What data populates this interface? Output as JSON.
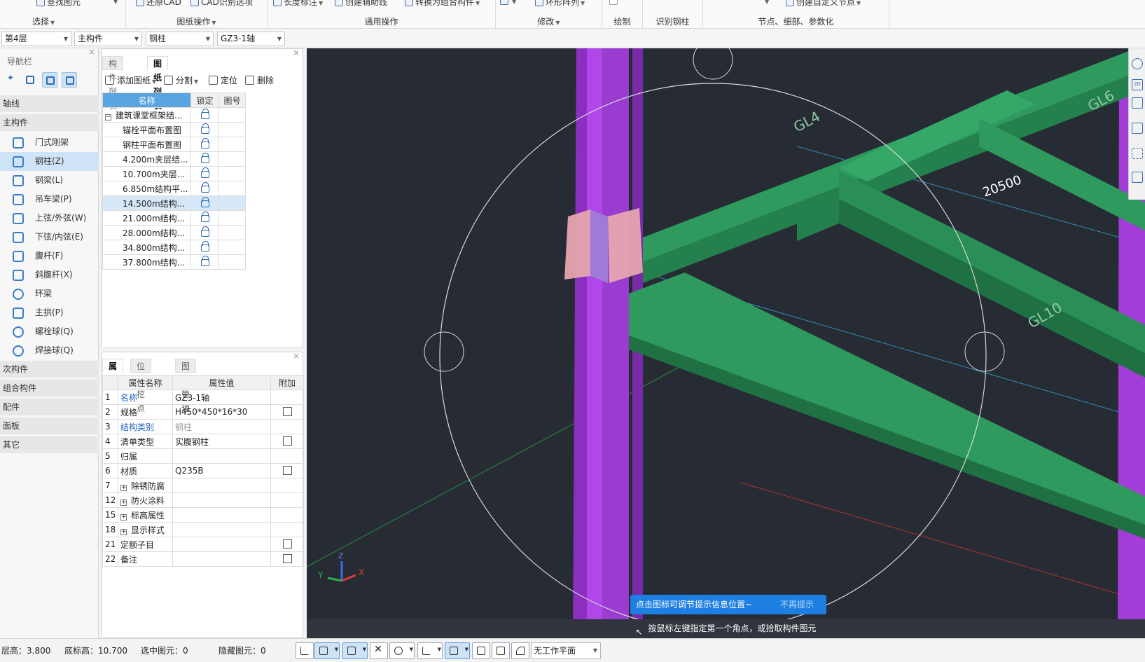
{
  "ribbon": {
    "select": {
      "items": [
        "查找图元"
      ],
      "label": "选择"
    },
    "drawing_ops": {
      "items": [
        "还原CAD",
        "CAD识别选项"
      ],
      "label": "图纸操作"
    },
    "general_ops": {
      "items": [
        "长度标注",
        "创建辅助线",
        "转换为组合构件"
      ],
      "label": "通用操作"
    },
    "modify": {
      "items": [
        "环形阵列"
      ],
      "label": "修改"
    },
    "draw": {
      "label": "绘制"
    },
    "identify": {
      "label": "识别钢柱"
    },
    "nodes": {
      "items": [
        "创建自定义节点"
      ],
      "label": "节点、细部、参数化"
    }
  },
  "selectors": {
    "floor": "第4层",
    "component_type": "主构件",
    "component": "钢柱",
    "instance": "GZ3-1轴"
  },
  "nav": {
    "title": "导航栏",
    "categories": {
      "axis": "轴线",
      "main": "主构件",
      "secondary": "次构件",
      "combo": "组合构件",
      "fittings": "配件",
      "panel": "面板",
      "other": "其它"
    },
    "items": [
      {
        "label": "门式刚架",
        "icon": "portal-frame-icon"
      },
      {
        "label": "钢柱(Z)",
        "icon": "steel-column-icon"
      },
      {
        "label": "钢梁(L)",
        "icon": "steel-beam-icon"
      },
      {
        "label": "吊车梁(P)",
        "icon": "crane-beam-icon"
      },
      {
        "label": "上弦/外弦(W)",
        "icon": "upper-chord-icon"
      },
      {
        "label": "下弦/内弦(E)",
        "icon": "lower-chord-icon"
      },
      {
        "label": "腹杆(F)",
        "icon": "web-member-icon"
      },
      {
        "label": "斜腹杆(X)",
        "icon": "diagonal-web-icon"
      },
      {
        "label": "环梁",
        "icon": "ring-beam-icon"
      },
      {
        "label": "主拱(P)",
        "icon": "main-arch-icon"
      },
      {
        "label": "螺栓球(Q)",
        "icon": "bolt-ball-icon"
      },
      {
        "label": "焊接球(Q)",
        "icon": "weld-ball-icon"
      }
    ]
  },
  "drawing_panel": {
    "tabs": [
      "构件列表",
      "图纸列表"
    ],
    "tools": [
      "添加图纸",
      "分割",
      "定位",
      "删除"
    ],
    "headers": [
      "名称",
      "锁定",
      "图号"
    ],
    "root": "建筑课堂框架结...",
    "rows": [
      "锚栓平面布置图",
      "钢柱平面布置图",
      "4.200m夹层结...",
      "10.700m夹层...",
      "6.850m结构平...",
      "14.500m结构...",
      "21.000m结构...",
      "28.000m结构...",
      "34.800m结构...",
      "37.800m结构..."
    ]
  },
  "properties_panel": {
    "tabs": [
      "属性",
      "位置挖点",
      "图层管理"
    ],
    "headers": [
      "属性名称",
      "属性值",
      "附加"
    ],
    "rows": [
      {
        "id": "1",
        "name": "名称",
        "value": "GZ3-1轴",
        "blue": true,
        "check": false,
        "expand": false
      },
      {
        "id": "2",
        "name": "规格",
        "value": "H450*450*16*30",
        "blue": false,
        "check": true,
        "expand": false
      },
      {
        "id": "3",
        "name": "结构类别",
        "value": "钢柱",
        "blue": true,
        "check": false,
        "expand": false,
        "gray": true
      },
      {
        "id": "4",
        "name": "清单类型",
        "value": "实腹钢柱",
        "blue": false,
        "check": true,
        "expand": false
      },
      {
        "id": "5",
        "name": "归属",
        "value": "",
        "blue": false,
        "check": false,
        "expand": false
      },
      {
        "id": "6",
        "name": "材质",
        "value": "Q235B",
        "blue": false,
        "check": true,
        "expand": false
      },
      {
        "id": "7",
        "name": "除锈防腐",
        "value": "",
        "blue": false,
        "check": false,
        "expand": true
      },
      {
        "id": "12",
        "name": "防火涂料",
        "value": "",
        "blue": false,
        "check": false,
        "expand": true
      },
      {
        "id": "15",
        "name": "标高属性",
        "value": "",
        "blue": false,
        "check": false,
        "expand": true
      },
      {
        "id": "18",
        "name": "显示样式",
        "value": "",
        "blue": false,
        "check": false,
        "expand": true
      },
      {
        "id": "21",
        "name": "定额子目",
        "value": "",
        "blue": false,
        "check": true,
        "expand": false
      },
      {
        "id": "22",
        "name": "备注",
        "value": "",
        "blue": false,
        "check": true,
        "expand": false
      }
    ]
  },
  "viewport": {
    "labels": [
      "GL4",
      "20500",
      "GL10",
      "GL6"
    ],
    "axis_labels": {
      "x": "X",
      "y": "Y",
      "z": "Z"
    },
    "tip_text": "点击图标可调节提示信息位置~",
    "tip_dismiss": "不再提示",
    "prompt": "按鼠标左键指定第一个角点，或拾取构件图元"
  },
  "status": {
    "floor_height": "层高：3.800",
    "base_elev": "底标高：10.700",
    "selected": "选中图元：0",
    "hidden": "隐藏图元：0",
    "work_plane": "无工作平面"
  },
  "colors": {
    "column": "#a33dd8",
    "beam": "#2e9a5e",
    "accent": "#1e7fe3",
    "viewport_bg": "#272b34"
  }
}
